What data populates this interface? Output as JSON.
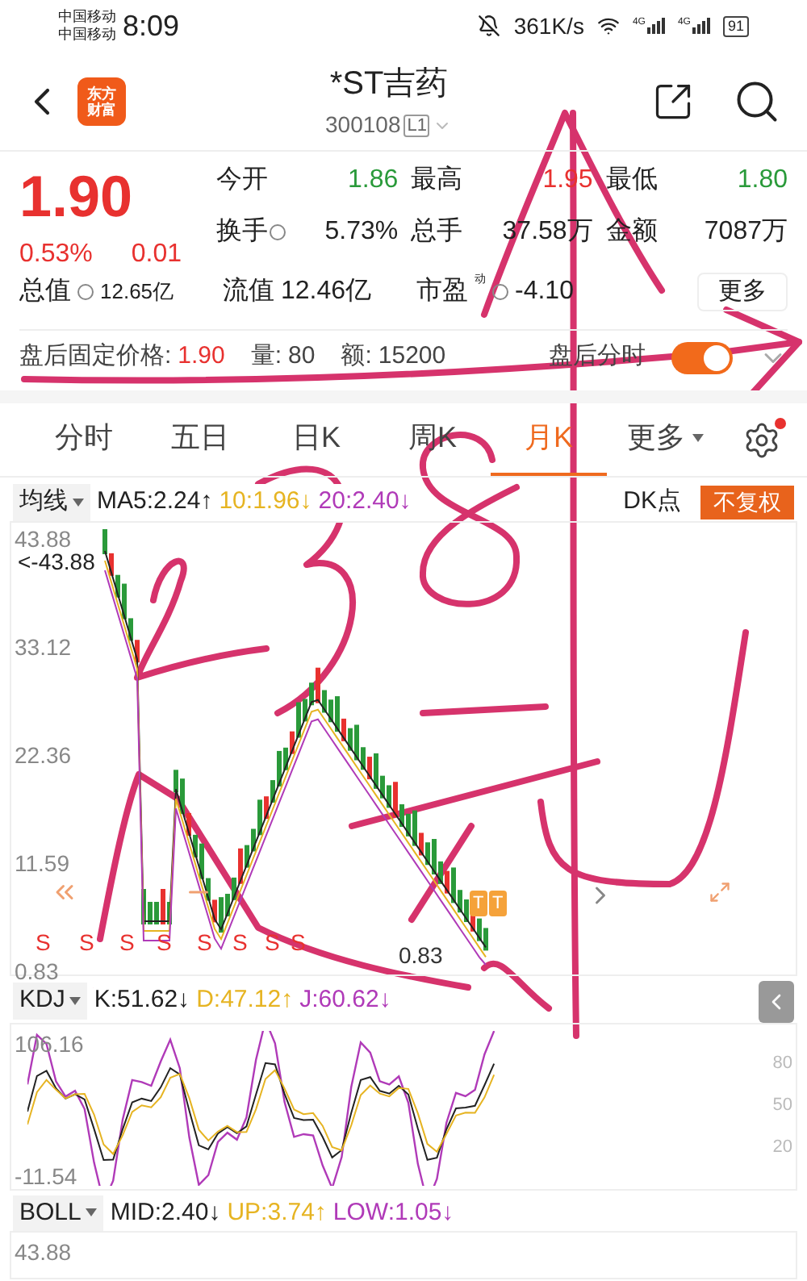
{
  "status_bar": {
    "carriers": [
      "中国移动",
      "中国移动"
    ],
    "time": "8:09",
    "speed": "361K/s",
    "networks": [
      "4G",
      "4G"
    ],
    "battery": "91"
  },
  "header": {
    "logo": [
      "东方",
      "财富"
    ],
    "title": "*ST吉药",
    "code": "300108",
    "level_badge": "L1"
  },
  "quote": {
    "price": "1.90",
    "change_pct": "0.53%",
    "change": "0.01",
    "stats": [
      [
        {
          "label": "今开",
          "value": "1.86",
          "color": "#2a9a3a"
        },
        {
          "label": "最高",
          "value": "1.95",
          "color": "#e8312f"
        },
        {
          "label": "最低",
          "value": "1.80",
          "color": "#2a9a3a"
        }
      ],
      [
        {
          "label": "换手",
          "info": true,
          "value": "5.73%",
          "color": "#222222"
        },
        {
          "label": "总手",
          "value": "37.58万",
          "color": "#222222"
        },
        {
          "label": "金额",
          "value": "7087万",
          "color": "#222222"
        }
      ],
      [
        {
          "label": "总值",
          "info": true,
          "value": "12.65亿",
          "color": "#222222",
          "small": true
        },
        {
          "label": "流值",
          "value": "12.46亿",
          "color": "#222222"
        },
        {
          "label": "市盈",
          "sup": "动",
          "info": true,
          "value": "-4.10",
          "color": "#222222"
        }
      ]
    ],
    "more_button": "更多"
  },
  "after_hours": {
    "items": [
      {
        "label": "盘后固定价格:",
        "value": "1.90",
        "color": "#e8312f"
      },
      {
        "label": "量:",
        "value": "80",
        "color": "#444444"
      },
      {
        "label": "额:",
        "value": "15200",
        "color": "#444444"
      }
    ],
    "toggle_label": "盘后分时",
    "on": true
  },
  "tabs": [
    {
      "label": "分时",
      "selected": false
    },
    {
      "label": "五日",
      "selected": false
    },
    {
      "label": "日K",
      "selected": false
    },
    {
      "label": "周K",
      "selected": false
    },
    {
      "label": "月K",
      "selected": true
    },
    {
      "label": "更多",
      "selected": false,
      "dropdown": true
    }
  ],
  "indicator_bar": {
    "selector": "均线",
    "values": [
      {
        "text": "MA5:2.24↑",
        "color": "#222222"
      },
      {
        "text": "10:1.96↓",
        "color": "#e6b422"
      },
      {
        "text": "20:2.40↓",
        "color": "#b03ab8"
      }
    ],
    "dk_button": "DK点",
    "adjust_button": "不复权"
  },
  "price_chart": {
    "y_labels": [
      "43.88",
      "33.12",
      "22.36",
      "11.59",
      "0.83"
    ],
    "high_marker": "<-43.88",
    "low_marker": "0.83",
    "signals": [
      "S",
      "S",
      "S",
      "S",
      "S",
      "S",
      "S",
      "S"
    ],
    "trade_badges": [
      "T",
      "T"
    ]
  },
  "kdj": {
    "selector": "KDJ",
    "values": [
      {
        "text": "K:51.62↓",
        "color": "#222222"
      },
      {
        "text": "D:47.12↑",
        "color": "#e6b422"
      },
      {
        "text": "J:60.62↓",
        "color": "#b03ab8"
      }
    ],
    "y_labels": [
      "106.16",
      "-11.54"
    ],
    "right_labels": [
      "80",
      "50",
      "20"
    ]
  },
  "boll": {
    "selector": "BOLL",
    "values": [
      {
        "text": "MID:2.40↓",
        "color": "#222222"
      },
      {
        "text": "UP:3.74↑",
        "color": "#e6b422"
      },
      {
        "text": "LOW:1.05↓",
        "color": "#b03ab8"
      }
    ],
    "top_label": "43.88"
  }
}
